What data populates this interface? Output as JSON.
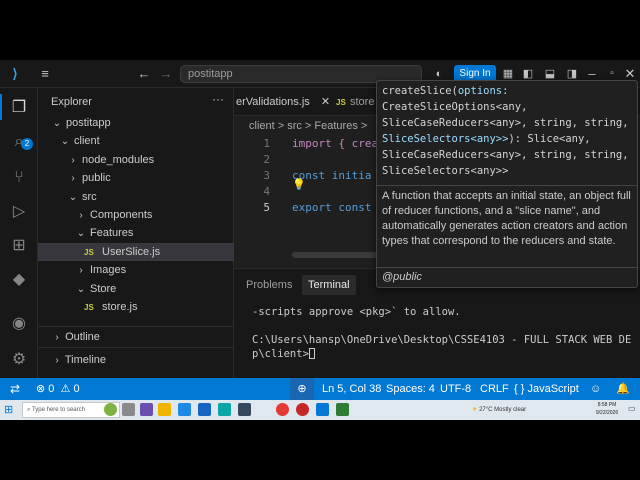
{
  "title_bar": {
    "search_placeholder": "postitapp",
    "sign_in": "Sign In"
  },
  "activity": {
    "badge": "2"
  },
  "explorer": {
    "title": "Explorer",
    "items": [
      {
        "label": "postitapp",
        "level": 0,
        "chevron": "v"
      },
      {
        "label": "client",
        "level": 1,
        "chevron": "v"
      },
      {
        "label": "node_modules",
        "level": 2,
        "chevron": ">"
      },
      {
        "label": "public",
        "level": 2,
        "chevron": ">"
      },
      {
        "label": "src",
        "level": 2,
        "chevron": "v"
      },
      {
        "label": "Components",
        "level": 3,
        "chevron": ">"
      },
      {
        "label": "Features",
        "level": 3,
        "chevron": "v"
      },
      {
        "label": "UserSlice.js",
        "level": 4,
        "chevron": "JS",
        "selected": true
      },
      {
        "label": "Images",
        "level": 3,
        "chevron": ">"
      },
      {
        "label": "Store",
        "level": 3,
        "chevron": "v"
      },
      {
        "label": "store.js",
        "level": 4,
        "chevron": "JS"
      }
    ],
    "outline": "Outline",
    "timeline": "Timeline"
  },
  "tabs": [
    {
      "label": "erValidations.js"
    },
    {
      "label": "store"
    }
  ],
  "breadcrumb": "client > src > Features > ",
  "code": {
    "lines": [
      {
        "n": "1",
        "text": "import { crea"
      },
      {
        "n": "2",
        "text": ""
      },
      {
        "n": "3",
        "text": "const  initia"
      },
      {
        "n": "4",
        "text": ""
      },
      {
        "n": "5",
        "text": "export const "
      }
    ]
  },
  "panel": {
    "tabs": [
      "Problems",
      "Terminal"
    ],
    "terminal_lines": [
      "-scripts approve <pkg>` to allow.",
      "",
      "C:\\Users\\hansp\\OneDrive\\Desktop\\CSSE4103 - FULL STACK WEB DE",
      "p\\client>"
    ]
  },
  "hover": {
    "signature_lines": [
      "createSlice(options:",
      "CreateSliceOptions<any,",
      "SliceCaseReducers<any>, string, string,",
      "SliceSelectors<any>>): Slice<any,",
      "SliceCaseReducers<any>, string, string,",
      "SliceSelectors<any>>"
    ],
    "doc": "A function that accepts an initial state, an object full of reducer functions, and a \"slice name\", and automatically generates action creators and action types that correspond to the reducers and state.",
    "tag": "@public"
  },
  "status": {
    "errors": "0",
    "warnings": "0",
    "position": "Ln 5, Col 38",
    "spaces": "Spaces: 4",
    "encoding": "UTF-8",
    "eol": "CRLF",
    "language": "JavaScript"
  },
  "taskbar": {
    "search": "Type here to search",
    "weather": "27°C  Mostly clear",
    "time": "8:58 PM",
    "date": "9/22/2026"
  }
}
